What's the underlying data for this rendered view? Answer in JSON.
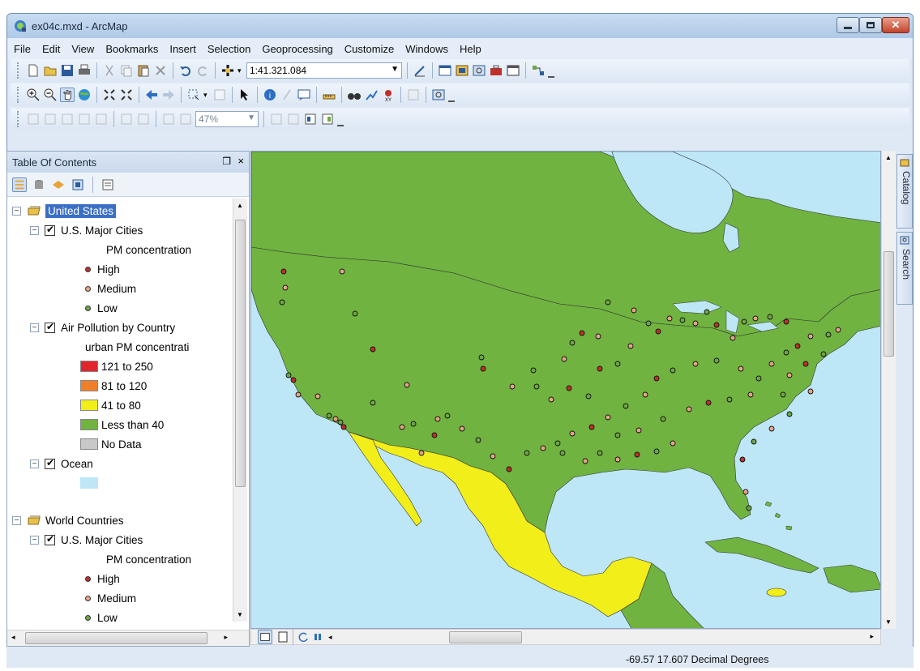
{
  "window": {
    "title": "ex04c.mxd - ArcMap"
  },
  "menu": [
    "File",
    "Edit",
    "View",
    "Bookmarks",
    "Insert",
    "Selection",
    "Geoprocessing",
    "Customize",
    "Windows",
    "Help"
  ],
  "toolbar": {
    "scale": "1:41.321.084",
    "zoom_percent": "47%"
  },
  "toc": {
    "title": "Table Of Contents",
    "pin_glyph": "❒",
    "close_glyph": "×",
    "frames": [
      {
        "name": "United States",
        "selected": true,
        "layers": [
          {
            "name": "U.S. Major Cities",
            "field": "PM concentration",
            "classes": [
              {
                "label": "High",
                "color": "#c0302b"
              },
              {
                "label": "Medium",
                "color": "#e6a48a"
              },
              {
                "label": "Low",
                "color": "#6fa646"
              }
            ]
          },
          {
            "name": "Air Pollution by Country",
            "field": "urban PM concentrati",
            "classes": [
              {
                "label": "121 to 250",
                "color": "#e0262c"
              },
              {
                "label": "81 to 120",
                "color": "#f07f2a"
              },
              {
                "label": "41 to 80",
                "color": "#f2ee1a"
              },
              {
                "label": "Less than 40",
                "color": "#70b340"
              },
              {
                "label": "No Data",
                "color": "#c8c8c8"
              }
            ]
          },
          {
            "name": "Ocean",
            "classes": [
              {
                "label": "",
                "color": "#bde7f7"
              }
            ]
          }
        ]
      },
      {
        "name": "World Countries",
        "selected": false,
        "layers": [
          {
            "name": "U.S. Major Cities",
            "field": "PM concentration",
            "classes": [
              {
                "label": "High",
                "color": "#c0302b"
              },
              {
                "label": "Medium",
                "color": "#e6a48a"
              },
              {
                "label": "Low",
                "color": "#6fa646"
              }
            ]
          }
        ]
      }
    ]
  },
  "side_tabs": {
    "catalog": "Catalog",
    "search": "Search"
  },
  "map_colors": {
    "ocean": "#bde7f7",
    "us": "#70b340",
    "canada": "#70b340",
    "mexico": "#f2ee1a",
    "central_america": "#70b340"
  },
  "status": {
    "coordinates": "-69.57  17.607 Decimal Degrees"
  }
}
